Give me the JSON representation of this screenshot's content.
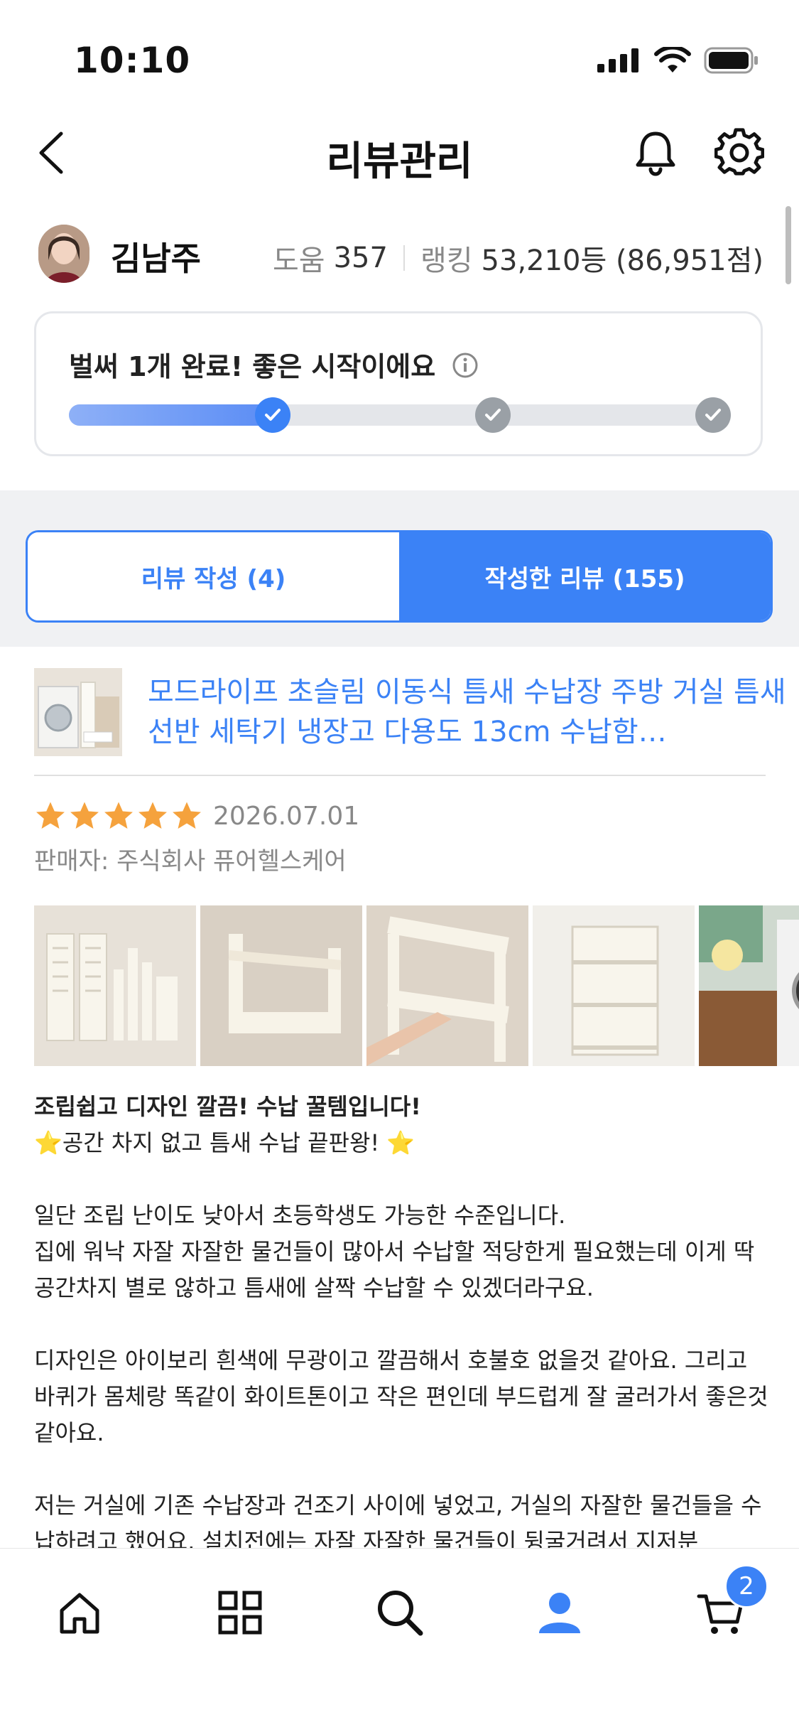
{
  "status_bar": {
    "time": "10:10"
  },
  "header": {
    "title": "리뷰관리"
  },
  "profile": {
    "name": "김남주",
    "help_label": "도움",
    "help_count": "357",
    "ranking_label": "랭킹",
    "ranking_value": "53,210등 (86,951점)"
  },
  "progress": {
    "message": "벌써 1개 완료! 좋은 시작이에요",
    "fraction_complete": 0.31,
    "steps": [
      {
        "done": true
      },
      {
        "done": false
      },
      {
        "done": false
      }
    ]
  },
  "tabs": [
    {
      "label": "리뷰 작성 (4)",
      "active": false
    },
    {
      "label": "작성한 리뷰 (155)",
      "active": true
    }
  ],
  "product": {
    "title": "모드라이프 초슬림 이동식 틈새 수납장 주방 거실 틈새 선반 세탁기 냉장고 다용도 13cm 수납함…"
  },
  "review": {
    "rating": 5,
    "date": "2026.07.01",
    "seller": "판매자: 주식회사 퓨어헬스케어",
    "headline": "조립쉽고 디자인 깔끔! 수납 꿀템입니다!",
    "subline": "⭐공간 차지 없고 틈새 수납 끝판왕! ⭐",
    "paragraph1_line1": "일단 조립 난이도 낮아서 초등학생도 가능한 수준입니다.",
    "paragraph1_line2": "집에 워낙 자잘 자잘한 물건들이 많아서 수납할 적당한게 필요했는데 이게 딱 공간차지 별로 않하고 틈새에 살짝 수납할 수 있겠더라구요.",
    "paragraph2": "디자인은 아이보리 흰색에 무광이고 깔끔해서 호불호 없을것 같아요. 그리고 바퀴가 몸체랑 똑같이 화이트톤이고 작은 편인데 부드럽게 잘 굴러가서 좋은것 같아요.",
    "paragraph3": "저는 거실에 기존 수납장과 건조기 사이에 넣었고, 거실의 자잘한 물건들을 수납하려고 했어요. 설치전에는 자잘 자잘한 물건들이 뒹굴거려서 지저분"
  },
  "nav": {
    "items": [
      "home-icon",
      "grid-icon",
      "search-icon",
      "profile-icon",
      "cart-icon"
    ],
    "cart_badge": "2"
  },
  "colors": {
    "accent": "#3b82f6",
    "star": "#f5a23d",
    "muted": "#888888"
  }
}
